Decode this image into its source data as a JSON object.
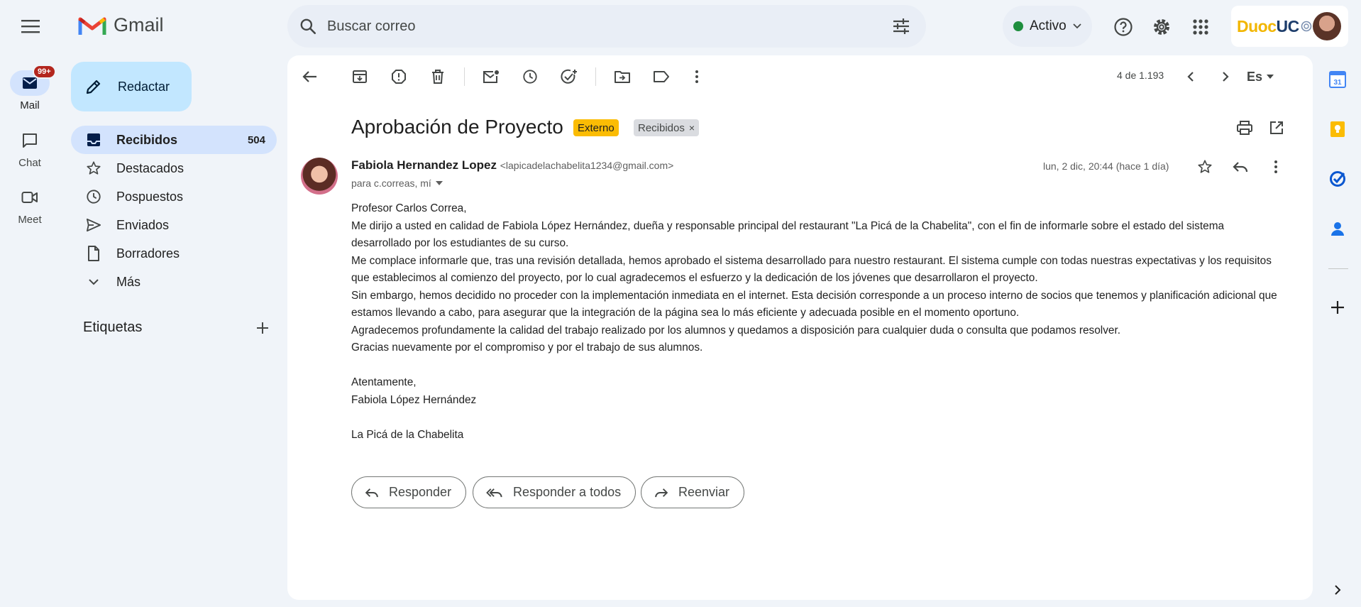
{
  "app": {
    "name": "Gmail"
  },
  "search": {
    "placeholder": "Buscar correo"
  },
  "status": {
    "label": "Activo"
  },
  "account": {
    "org_part1": "Duoc",
    "org_part2": "UC"
  },
  "rail": {
    "mail": {
      "label": "Mail",
      "badge": "99+"
    },
    "chat": {
      "label": "Chat"
    },
    "meet": {
      "label": "Meet"
    }
  },
  "compose": {
    "label": "Redactar"
  },
  "nav": {
    "items": [
      {
        "label": "Recibidos",
        "count": "504"
      },
      {
        "label": "Destacados"
      },
      {
        "label": "Pospuestos"
      },
      {
        "label": "Enviados"
      },
      {
        "label": "Borradores"
      },
      {
        "label": "Más"
      }
    ],
    "labels_heading": "Etiquetas"
  },
  "toolbar": {
    "pager": "4 de 1.193",
    "lang": "Es"
  },
  "email": {
    "subject": "Aprobación de Proyecto",
    "chips": {
      "external": "Externo",
      "inbox": "Recibidos",
      "remove": "×"
    },
    "sender_name": "Fabiola Hernandez Lopez",
    "sender_email": "<lapicadelachabelita1234@gmail.com>",
    "recipients": "para c.correas, mí",
    "date": "lun, 2 dic, 20:44 (hace 1 día)",
    "body": {
      "greeting": "Profesor Carlos Correa,",
      "p1": "Me dirijo a usted en calidad de Fabiola López Hernández, dueña y responsable principal del restaurant \"La Picá de la Chabelita\", con el fin de informarle sobre el estado del sistema desarrollado por los estudiantes de su curso.",
      "p2": "Me complace informarle que, tras una revisión detallada, hemos aprobado el sistema desarrollado para nuestro restaurant. El sistema cumple con todas nuestras expectativas y los requisitos que establecimos al comienzo del proyecto, por lo cual agradecemos el esfuerzo y la dedicación de los jóvenes que desarrollaron el proyecto.",
      "p3": "Sin embargo, hemos decidido no proceder con la implementación inmediata en el internet. Esta decisión corresponde a un proceso interno de socios que tenemos y planificación adicional que estamos llevando a cabo, para asegurar que la integración de la página sea lo más eficiente y adecuada posible en el momento oportuno.",
      "p4": "Agradecemos profundamente la calidad del trabajo realizado por los alumnos y quedamos a disposición para cualquier duda o consulta que podamos resolver.",
      "p5": "Gracias nuevamente por el compromiso y por el trabajo de sus alumnos.",
      "closing": "Atentamente,",
      "signature_name": "Fabiola López Hernández",
      "signature_org": "La Picá de la Chabelita"
    }
  },
  "actions": {
    "reply": "Responder",
    "reply_all": "Responder a todos",
    "forward": "Reenviar"
  },
  "right_rail": {
    "calendar_day": "31"
  },
  "colors": {
    "accent": "#0b57d0",
    "selected": "#d3e3fd",
    "compose": "#c2e7ff",
    "external_chip": "#fbbc04",
    "badge": "#b3261e",
    "active_dot": "#1e8e3e"
  }
}
